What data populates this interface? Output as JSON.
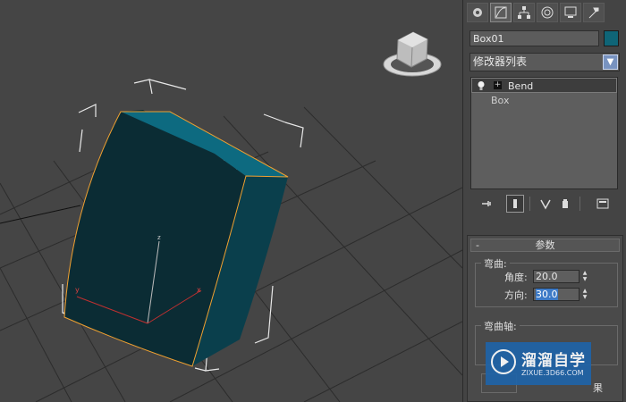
{
  "viewport": {
    "axis_z": "z",
    "axis_x": "x",
    "axis_y": "y"
  },
  "command_panel": {
    "tabs": [
      "create",
      "modify",
      "hierarchy",
      "motion",
      "display",
      "utilities"
    ],
    "object_name": "Box01",
    "object_color": "#0f6577",
    "modifier_list_label": "修改器列表",
    "stack_items": [
      {
        "label": "Bend",
        "selected": true
      },
      {
        "label": "Box",
        "selected": false
      }
    ],
    "params": {
      "header_minus": "-",
      "header_title": "参数",
      "bend_group_title": "弯曲:",
      "angle_label": "角度:",
      "angle_value": "20.0",
      "direction_label": "方向:",
      "direction_value": "30.0",
      "bend_axis_title": "弯曲轴:",
      "partial_bottom_right": "果"
    }
  },
  "watermark": {
    "title": "溜溜自学",
    "subtitle": "ZIXUE.3D66.COM"
  }
}
